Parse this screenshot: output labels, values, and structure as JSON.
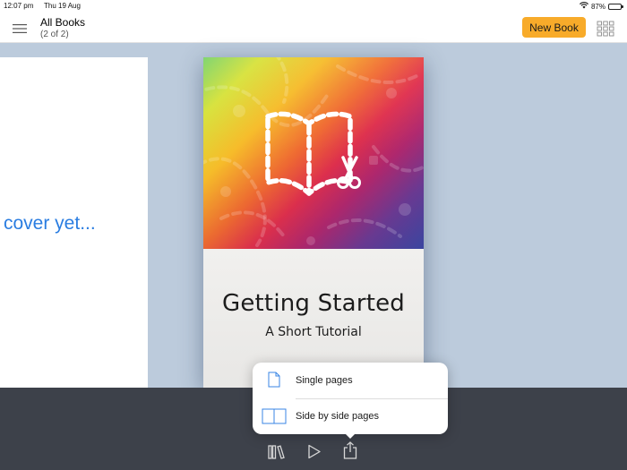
{
  "status_bar": {
    "time": "12:07 pm",
    "date": "Thu 19 Aug",
    "battery": "87%",
    "battery_level": 0.87
  },
  "nav": {
    "title": "All Books",
    "subtitle": "(2 of 2)",
    "new_book_label": "New Book",
    "accent_color": "#f8ab2a"
  },
  "left_book": {
    "text": "cover yet..."
  },
  "book": {
    "title": "Getting Started",
    "subtitle": "A Short Tutorial"
  },
  "popover": {
    "items": [
      {
        "label": "Single pages",
        "icon": "single-page-icon"
      },
      {
        "label": "Side by side pages",
        "icon": "side-by-side-pages-icon"
      }
    ]
  },
  "toolbar": {
    "icons": [
      "library-icon",
      "play-icon",
      "share-icon"
    ]
  }
}
